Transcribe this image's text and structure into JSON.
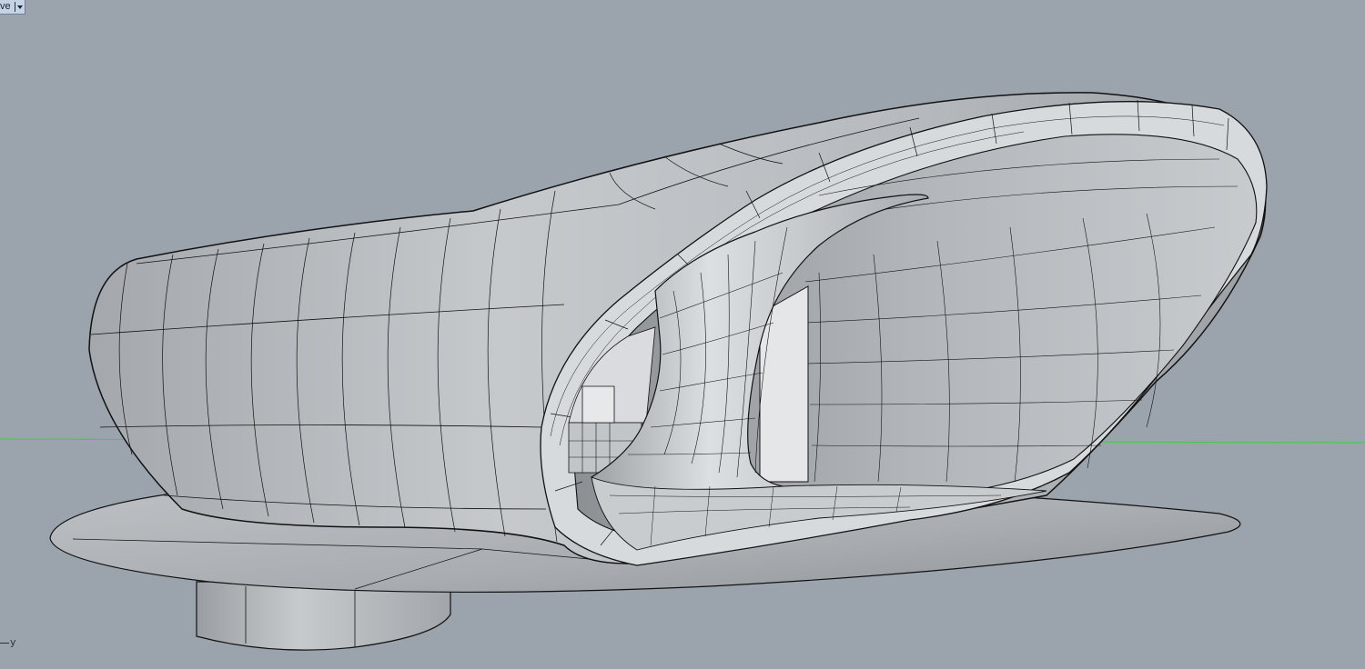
{
  "viewport": {
    "title": "ve",
    "axis_label": "y",
    "background": "#9ba3ad",
    "world_axis_color": "#3cd03c"
  },
  "scene": {
    "surface_fill": "#b8bcc0",
    "surface_light": "#d9dcdf",
    "surface_dark": "#8e9398",
    "isocurve_color": "#111111"
  }
}
